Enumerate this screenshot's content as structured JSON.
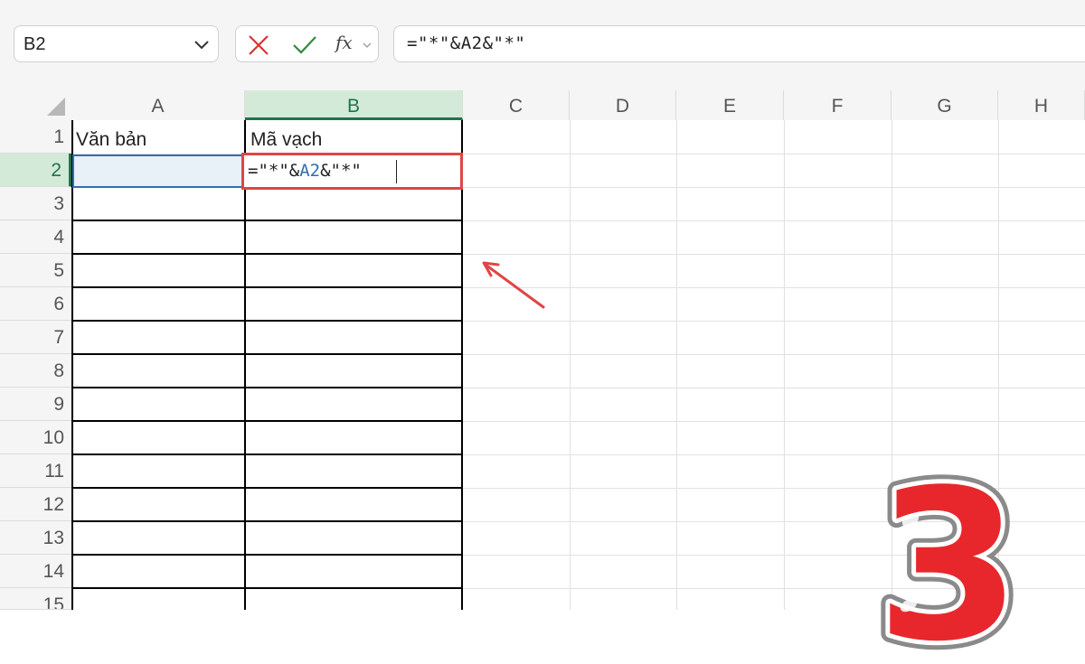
{
  "formula_bar": {
    "name_box": "B2",
    "cancel_icon": "close-icon",
    "enter_icon": "check-icon",
    "function_label": "fx",
    "formula": "=\"*\"&A2&\"*\""
  },
  "columns": [
    "A",
    "B",
    "C",
    "D",
    "E",
    "F",
    "G",
    "H"
  ],
  "selected_column": "B",
  "rows": [
    "1",
    "2",
    "3",
    "4",
    "5",
    "6",
    "7",
    "8",
    "9",
    "10",
    "11",
    "12",
    "13",
    "14",
    "15"
  ],
  "selected_row": "2",
  "cells": {
    "A1": "Văn bản",
    "B1": "Mã vạch",
    "B2_edit": {
      "part1": "=\"*\"&",
      "ref": "A2",
      "part2": "&\"*\""
    }
  },
  "step_badge": "3",
  "colors": {
    "accent_green": "#217346",
    "highlight_red": "#e04545",
    "ref_blue": "#2f6fb3"
  }
}
